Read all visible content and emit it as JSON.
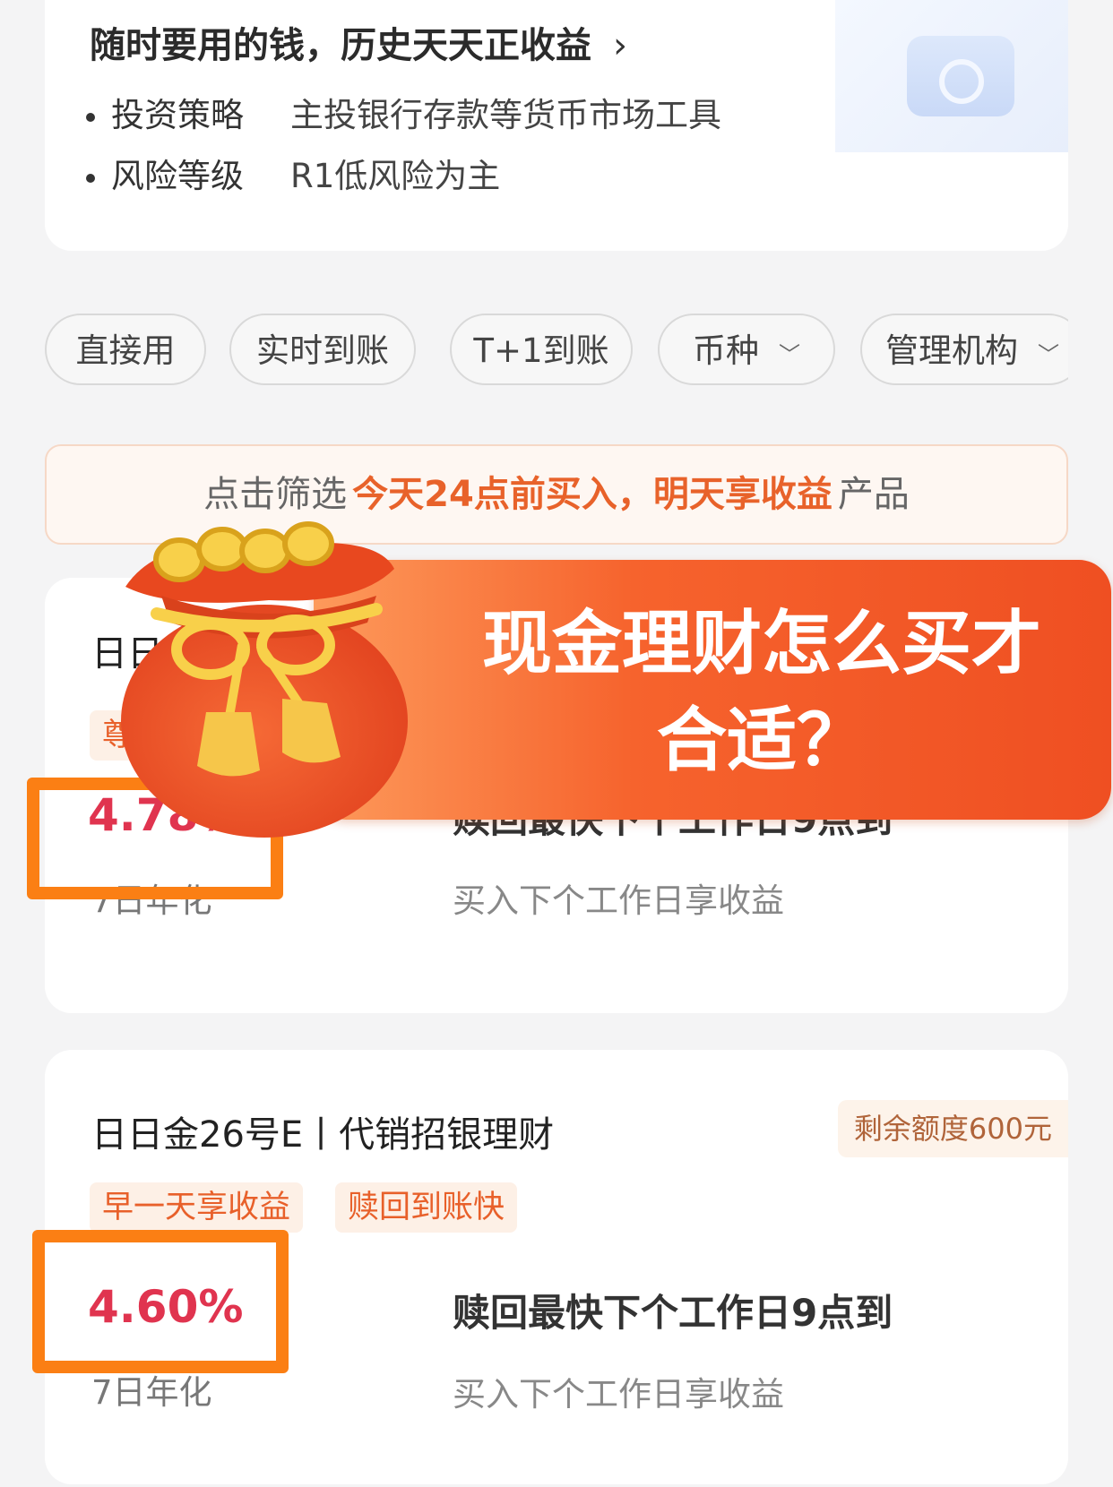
{
  "intro": {
    "title": "随时要用的钱，历史天天正收益",
    "chevron": "›",
    "items": [
      {
        "key": "投资策略",
        "value": "主投银行存款等货币市场工具"
      },
      {
        "key": "风险等级",
        "value": "R1低风险为主"
      }
    ]
  },
  "filters": [
    {
      "label": "直接用"
    },
    {
      "label": "实时到账"
    },
    {
      "label": "T+1到账"
    },
    {
      "label": "币种",
      "caret": "﹀"
    },
    {
      "label": "管理机构",
      "caret": "﹀"
    }
  ],
  "banner": {
    "prefix": "点击筛选",
    "highlight": "今天24点前买入，明天享收益",
    "suffix": "产品"
  },
  "overlay": {
    "line1": "现金理财怎么买才",
    "line2": "合适？"
  },
  "products": [
    {
      "title_partial": "日日",
      "tag_partial": "尊",
      "rate": "4.78%",
      "rate_label": "7日年化",
      "redeem": "赎回最快下个工作日9点到",
      "redeem_sub": "买入下个工作日享收益"
    },
    {
      "title": "日日金26号E丨代销招银理财",
      "quota": "剩余额度600元",
      "tags": [
        "早一天享收益",
        "赎回到账快"
      ],
      "rate": "4.60%",
      "rate_label": "7日年化",
      "redeem": "赎回最快下个工作日9点到",
      "redeem_sub": "买入下个工作日享收益"
    }
  ],
  "colors": {
    "accent": "#e8622a",
    "rate": "#e0344f",
    "highlight_box": "#fb7f14"
  }
}
